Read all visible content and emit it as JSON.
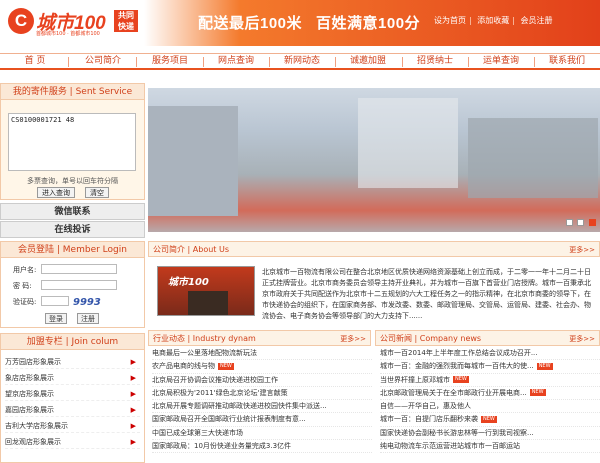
{
  "header": {
    "logo_mark": "C",
    "logo_name": "城市100",
    "logo_badge": "共同\n快递",
    "logo_sub": "首都城市100 · 首都城市100",
    "slogan": "配送最后100米   百姓满意100分",
    "links": [
      "设为首页",
      "添加收藏",
      "会员注册"
    ]
  },
  "nav": {
    "items": [
      "首 页",
      "公司简介",
      "服务项目",
      "网点查询",
      "新网动态",
      "诚邀加盟",
      "招贤纳士",
      "运单查询",
      "联系我们"
    ]
  },
  "tracking": {
    "title": "我的寄件服务 | Sent Service",
    "value": "CS0100001721 48",
    "hint": "多票查询，单号以回车符分隔",
    "query_btn": "进入查询",
    "clear_btn": "清空"
  },
  "links_panel": {
    "wechat": "微信联系",
    "complaint": "在线投诉"
  },
  "login": {
    "title": "会员登陆 | Member Login",
    "user_label": "用户名:",
    "pass_label": "密 码:",
    "code_label": "验证码:",
    "captcha": "9993",
    "login_btn": "登录",
    "register_btn": "注册"
  },
  "join": {
    "title": "加盟专栏 | Join colum",
    "items": [
      "万芳园店形象展示",
      "象店店形象展示",
      "望京店形象展示",
      "嘉园店形象展示",
      "吉利大学店形象展示",
      "回龙观店形象展示"
    ]
  },
  "banner": {
    "dots": [
      "1",
      "2",
      "3"
    ],
    "active": 2
  },
  "about": {
    "title": "公司简介 | About Us",
    "more": "更多>>",
    "img_label": "城市100",
    "text": "北京城市一百物流有限公司在整合北京地区优质快递网络资源基础上创立而成，于二零一一年十二月二十日正式挂牌营业。北京市商务委员会领导主持开业典礼，并为城市一百旗下首营业门店授牌。城市一百秉承北京市政府关于共同配送作为北京市十二五规划的六大工程任务之一的指示精神，在北京市商委的领导下，在市快递协会的组织下，在国家商务部、市发改委、数委、邮政管理局、交管局、运管局、建委、社会办、物流协会、电子商务协会等领导部门的大力支持下......"
  },
  "industry": {
    "title": "行业动态 | Industry dynam",
    "more": "更多>>",
    "items": [
      {
        "text": "电商最后一公里落地配物流新玩法",
        "new": false
      },
      {
        "text": "农产品电商的线与物",
        "new": true
      },
      {
        "text": "北京局召开协调会议推动快递进校园工作",
        "new": false
      },
      {
        "text": "北京局积极为'2011'绿色北京论坛'建言献策",
        "new": false
      },
      {
        "text": "北京局开展专题调研推动邮政快递进校园快件集中派送...",
        "new": false
      },
      {
        "text": "国家邮政局召开全国邮政行业统计报表制度有意...",
        "new": false
      },
      {
        "text": "中国已成全球第三大快递市场",
        "new": false
      },
      {
        "text": "国家邮政局：10月份快递业务量完成3.3亿件",
        "new": false
      }
    ]
  },
  "company_news": {
    "title": "公司新闻 | Company news",
    "more": "更多>>",
    "items": [
      {
        "text": "城市一百2014年上半年度工作总结会议成功召开...",
        "new": false
      },
      {
        "text": "城市一百：金融的强烈我而每城市一百伟大的使...",
        "new": true
      },
      {
        "text": "当世界杆撞上原邓城市",
        "new": true
      },
      {
        "text": "北京邮政管理局关于在全市邮政行业开展电商...",
        "new": true
      },
      {
        "text": "自信——开华自己，惠及他人",
        "new": false
      },
      {
        "text": "城市一百：自提门店乐翻秒来袭",
        "new": true
      },
      {
        "text": "国家快递协会副秘书长游忠林等一行到我司视察...",
        "new": false
      },
      {
        "text": "纯电动物流车示范运营进站城市市一百邮运站",
        "new": false
      }
    ]
  },
  "colors": {
    "brand": "#e8421f",
    "nav_text": "#d0401a",
    "panel_bg": "#fbe8d6"
  }
}
